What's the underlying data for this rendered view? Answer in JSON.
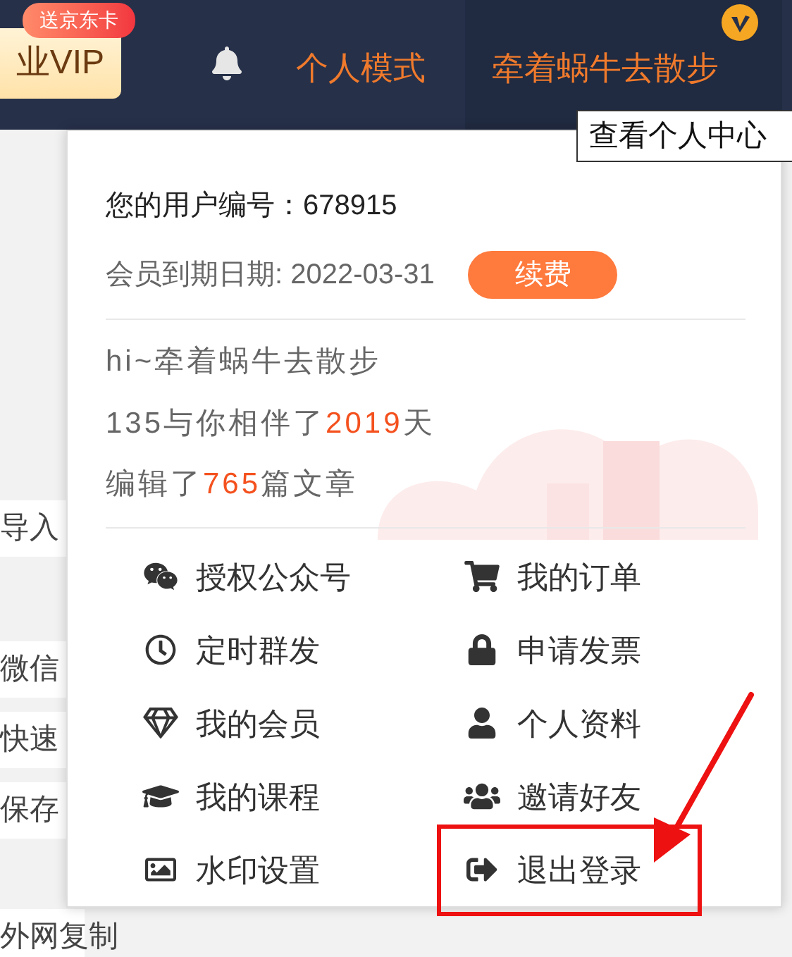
{
  "header": {
    "vip_button": "业VIP",
    "badge": "送京东卡",
    "mode_link": "个人模式",
    "username": "牵着蜗牛去散步",
    "tooltip": "查看个人中心"
  },
  "sidebar_items": [
    "导入",
    "微信",
    "快速",
    "保存",
    "外网复制"
  ],
  "dropdown": {
    "user_id": "您的用户编号：678915",
    "expiry": "会员到期日期: 2022-03-31",
    "renew_button": "续费",
    "greeting": "hi~牵着蜗牛去散步",
    "stats": [
      {
        "before": "135与你相伴了",
        "number": "2019",
        "after": "天"
      },
      {
        "before": "编辑了",
        "number": "765",
        "after": "篇文章"
      }
    ],
    "menu": [
      "授权公众号",
      "我的订单",
      "定时群发",
      "申请发票",
      "我的会员",
      "个人资料",
      "我的课程",
      "邀请好友",
      "水印设置",
      "退出登录"
    ]
  }
}
